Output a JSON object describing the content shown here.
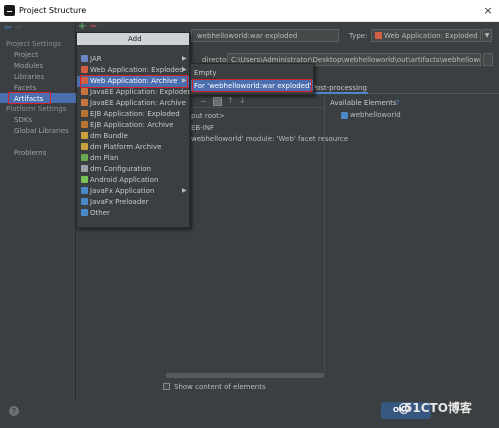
{
  "window": {
    "title": "Project Structure",
    "close_glyph": "×"
  },
  "toolbar": {
    "add_glyph": "+",
    "remove_glyph": "−"
  },
  "sidebar": {
    "project_settings_header": "Project Settings",
    "project_settings_items": [
      "Project",
      "Modules",
      "Libraries",
      "Facets",
      "Artifacts"
    ],
    "platform_settings_header": "Platform Settings",
    "platform_settings_items": [
      "SDKs",
      "Global Libraries"
    ],
    "problems": "Problems",
    "selected": "Artifacts"
  },
  "artifact": {
    "name_value": "webhelloworld:war exploded",
    "type_label": "Type:",
    "type_value": "Web Application: Exploded",
    "type_icon": "web-app-icon",
    "output_dir_label": "directory:",
    "output_dir_value": "C:\\Users\\Administrator\\Desktop\\webhelloworld\\out\\artifacts\\webhelloworld",
    "tab_post_processing": "Post-processing",
    "available_elements_label": "Available Elements",
    "available_help": "?",
    "tree_root": "put root>",
    "tree_webinf": "EB-INF",
    "tree_facet": "webhelloworld' module: 'Web' facet resource",
    "available_item": "webhelloworld",
    "show_content_label": "Show content of elements"
  },
  "add_menu": {
    "header": "Add",
    "items": [
      {
        "label": "JAR",
        "icon": "jar-icon",
        "submenu": true
      },
      {
        "label": "Web Application: Exploded",
        "icon": "web-app-icon",
        "submenu": true
      },
      {
        "label": "Web Application: Archive",
        "icon": "web-app-icon",
        "submenu": true
      },
      {
        "label": "JavaEE Application: Exploded",
        "icon": "javaee-icon",
        "submenu": false
      },
      {
        "label": "JavaEE Application: Archive",
        "icon": "javaee-icon",
        "submenu": false
      },
      {
        "label": "EJB Application: Exploded",
        "icon": "ejb-icon",
        "submenu": false
      },
      {
        "label": "EJB Application: Archive",
        "icon": "ejb-icon",
        "submenu": false
      },
      {
        "label": "dm Bundle",
        "icon": "dm-bundle-icon",
        "submenu": false
      },
      {
        "label": "dm Platform Archive",
        "icon": "dm-platform-icon",
        "submenu": false
      },
      {
        "label": "dm Plan",
        "icon": "dm-plan-icon",
        "submenu": false
      },
      {
        "label": "dm Configuration",
        "icon": "dm-config-icon",
        "submenu": false
      },
      {
        "label": "Android Application",
        "icon": "android-icon",
        "submenu": false
      },
      {
        "label": "JavaFx Application",
        "icon": "javafx-icon",
        "submenu": true
      },
      {
        "label": "JavaFx Preloader",
        "icon": "javafx-icon",
        "submenu": false
      },
      {
        "label": "Other",
        "icon": "other-icon",
        "submenu": false
      }
    ],
    "highlighted": "Web Application: Archive"
  },
  "sub_menu": {
    "items": [
      "Empty",
      "For 'webhelloworld:war exploded'"
    ],
    "highlighted": "For 'webhelloworld:war exploded'"
  },
  "footer": {
    "help_glyph": "?",
    "ok_label": "OK",
    "watermark_at": "@",
    "watermark": "51CTO博客"
  },
  "colors": {
    "background": "#3c3f41",
    "selection": "#4b6eaf",
    "annotation_red": "#d4202a",
    "primary_button": "#365880"
  }
}
